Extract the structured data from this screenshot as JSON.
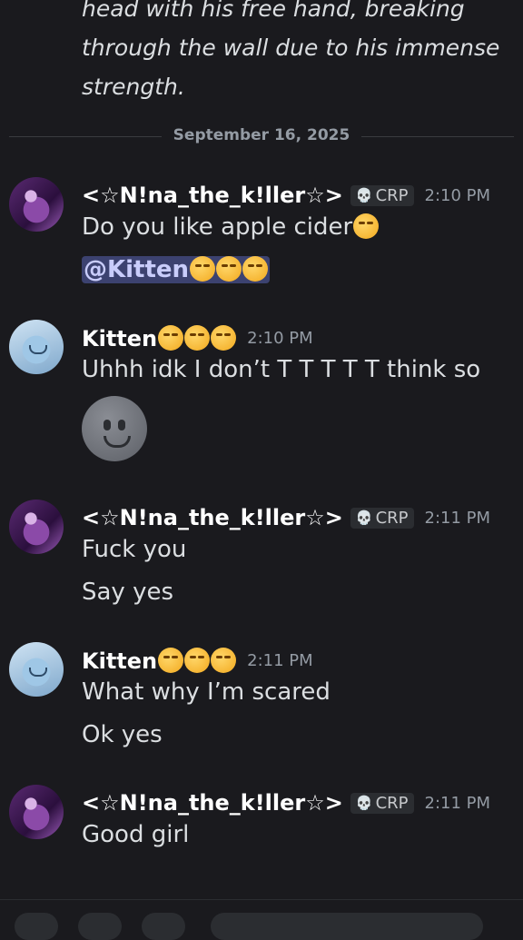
{
  "previous_message": {
    "partial_top_line": "head with his free hand, breaking",
    "lines": [
      "through the wall due to his immense",
      "strength."
    ]
  },
  "date_divider": "September 16, 2025",
  "messages": [
    {
      "author": "<☆N!na_the_k!ller☆>",
      "tag": "CRP",
      "tag_icon": "💀",
      "time": "2:10 PM",
      "avatar": "nina-avatar",
      "lines": [
        "Do you like apple cider"
      ],
      "mention": "@Kitten"
    },
    {
      "author": "Kitten",
      "time": "2:10 PM",
      "avatar": "kitten-avatar",
      "lines": [
        "Uhhh idk I don’t T T T T T think so"
      ],
      "big_emoji": "smile-emoji"
    },
    {
      "author": "<☆N!na_the_k!ller☆>",
      "tag": "CRP",
      "tag_icon": "💀",
      "time": "2:11 PM",
      "avatar": "nina-avatar",
      "lines": [
        "Fuck you",
        "Say yes"
      ]
    },
    {
      "author": "Kitten",
      "time": "2:11 PM",
      "avatar": "kitten-avatar",
      "lines": [
        "What why I’m scared",
        "Ok yes"
      ]
    },
    {
      "author": "<☆N!na_the_k!ller☆>",
      "tag": "CRP",
      "tag_icon": "💀",
      "time": "2:11 PM",
      "avatar": "nina-avatar",
      "lines": [
        "Good girl"
      ]
    }
  ]
}
